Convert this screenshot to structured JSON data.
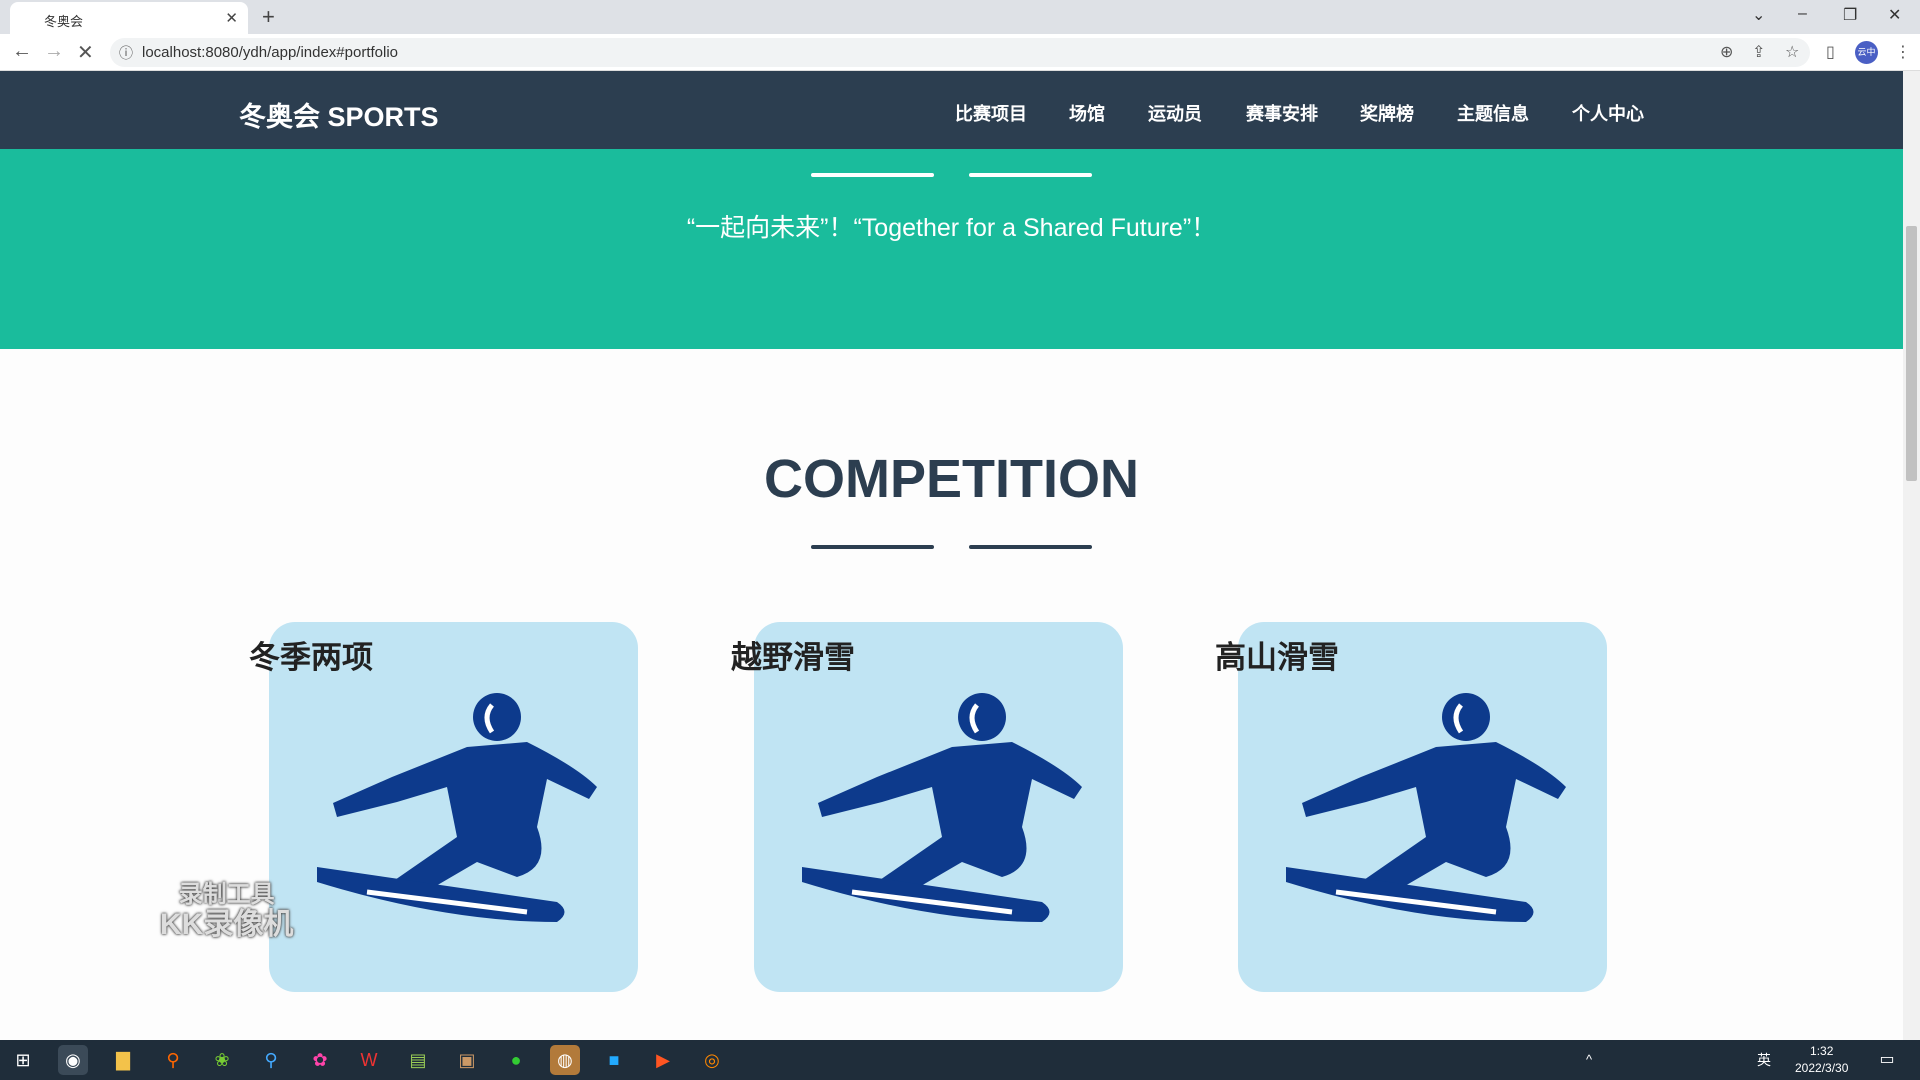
{
  "browser": {
    "tab_title": "冬奥会",
    "url": "localhost:8080/ydh/app/index#portfolio",
    "profile": "云中"
  },
  "navbar": {
    "brand": "冬奥会 SPORTS",
    "items": [
      "比赛项目",
      "场馆",
      "运动员",
      "赛事安排",
      "奖牌榜",
      "主题信息",
      "个人中心"
    ]
  },
  "hero": {
    "quote": "“一起向未来”！“Together for a Shared Future”！"
  },
  "section": {
    "title": "COMPETITION",
    "cards": [
      {
        "title": "冬季两项",
        "icon": "snowboard-athlete-icon"
      },
      {
        "title": "越野滑雪",
        "icon": "snowboard-athlete-icon"
      },
      {
        "title": "高山滑雪",
        "icon": "snowboard-athlete-icon"
      }
    ]
  },
  "watermark": {
    "line1": "录制工具",
    "line2": "KK录像机"
  },
  "taskbar": {
    "time": "1:32",
    "date": "2022/3/30",
    "ime": "英"
  },
  "colors": {
    "navbar": "#2c3e50",
    "hero": "#1abc9c",
    "card": "#c0e4f3",
    "athlete": "#0d3a8c"
  }
}
